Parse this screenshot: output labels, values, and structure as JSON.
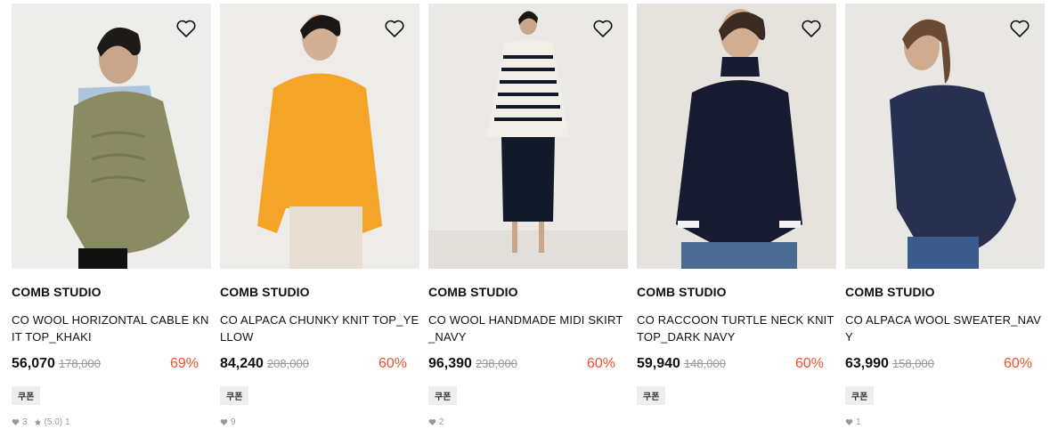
{
  "products": [
    {
      "brand": "COMB STUDIO",
      "name": "CO WOOL HORIZONTAL CABLE KNIT TOP_KHAKI",
      "price": "56,070",
      "original_price": "178,000",
      "discount": "69%",
      "coupon": "쿠폰",
      "likes": "3",
      "rating": "(5.0)",
      "reviews": "1",
      "bg_color": "#ededeb",
      "garment_color": "#8a8b63",
      "accent_color": "#aec4dd"
    },
    {
      "brand": "COMB STUDIO",
      "name": "CO ALPACA CHUNKY KNIT TOP_YELLOW",
      "price": "84,240",
      "original_price": "208,000",
      "discount": "60%",
      "coupon": "쿠폰",
      "likes": "9",
      "bg_color": "#eeece9",
      "garment_color": "#f4a528",
      "accent_color": "#e7ddd2"
    },
    {
      "brand": "COMB STUDIO",
      "name": "CO WOOL HANDMADE MIDI SKIRT_NAVY",
      "price": "96,390",
      "original_price": "238,000",
      "discount": "60%",
      "coupon": "쿠폰",
      "likes": "2",
      "bg_color": "#ebe9e6",
      "garment_color": "#121a2a",
      "accent_color": "#f2efe8"
    },
    {
      "brand": "COMB STUDIO",
      "name": "CO RACCOON TURTLE NECK KNIT TOP_DARK NAVY",
      "price": "59,940",
      "original_price": "148,000",
      "discount": "60%",
      "coupon": "쿠폰",
      "likes": "",
      "bg_color": "#e6e3df",
      "garment_color": "#161b30",
      "accent_color": "#4c6b92"
    },
    {
      "brand": "COMB STUDIO",
      "name": "CO ALPACA WOOL SWEATER_NAVY",
      "price": "63,990",
      "original_price": "158,000",
      "discount": "60%",
      "coupon": "쿠폰",
      "likes": "1",
      "bg_color": "#e9e7e4",
      "garment_color": "#27304f",
      "accent_color": "#3b5b8c"
    }
  ]
}
